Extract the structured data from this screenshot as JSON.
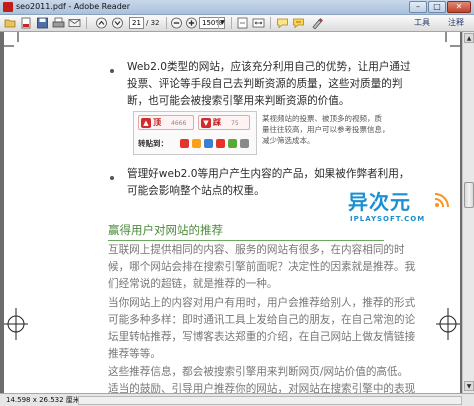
{
  "window": {
    "title": "seo2011.pdf - Adobe Reader",
    "controls": {
      "minimize": "–",
      "maximize": "□",
      "close": "✕"
    }
  },
  "toolbar": {
    "page_current": "21",
    "page_total": "/ 32",
    "zoom": "150%",
    "tools_label": "工具",
    "comment_label": "注释"
  },
  "document": {
    "bullet1": [
      "Web2.0类型的网站，应该充分利用自己的优势，让用户通过",
      "投票、评论等手段自己去判断资源的质量，这些对质量的判",
      "断，也可能会被搜索引擎用来判断资源的价值。"
    ],
    "share_widget": {
      "up_label": "顶",
      "up_count": "4666",
      "down_label": "踩",
      "down_count": "75",
      "share_label": "转贴到："
    },
    "caption": [
      "某视频站的投票、被顶多的视频，质",
      "量往往较高，用户可以参考投票信息，",
      "减少筛选成本。"
    ],
    "bullet2": [
      "管理好web2.0等用户产生内容的产品，如果被作弊者利用，",
      "可能会影响整个站点的权重。"
    ],
    "logo": {
      "cn": "异次元",
      "en": "IPLAYSOFT.COM"
    },
    "section_title": "赢得用户对网站的推荐",
    "para1": [
      "互联网上提供相同的内容、服务的网站有很多，在内容相同的时",
      "候，哪个网站会排在搜索引擎前面呢？决定性的因素就是推荐。我",
      "们经常说的超链，就是推荐的一种。"
    ],
    "para2": [
      "当你网站上的内容对用户有用时，用户会推荐给别人，推荐的形式",
      "可能多种多样：即时通讯工具上发给自己的朋友，在自己常泡的论",
      "坛里转帖推荐，写博客表达郑重的介绍，在自己网站上做友情链接",
      "推荐等等。"
    ],
    "para3": [
      "这些推荐信息，都会被搜索引擎用来判断网页/网站价值的高低。",
      "适当的鼓励、引导用户推荐你的网站，对网站在搜索引擎中的表现"
    ]
  },
  "statusbar": {
    "dimensions": "14.598 x 26.532 厘米"
  }
}
